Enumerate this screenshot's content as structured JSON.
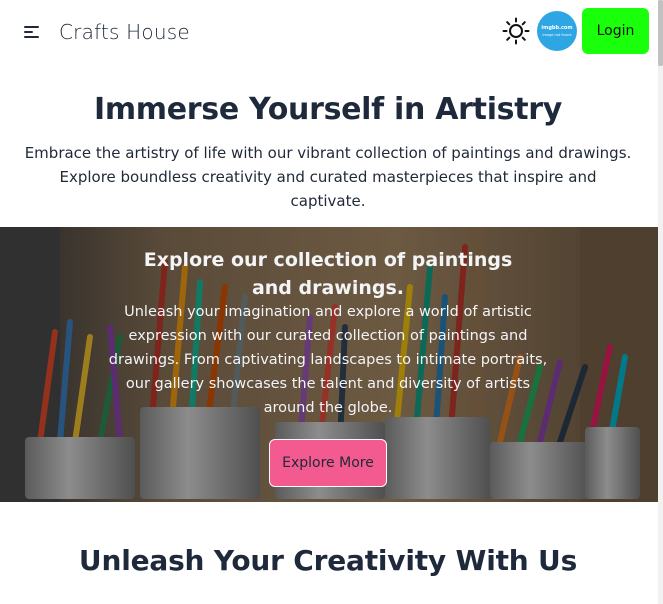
{
  "navbar": {
    "brand": "Crafts House",
    "menu_icon": "hamburger-icon",
    "theme_icon": "sun-icon",
    "avatar": {
      "line1": "imgbb.com",
      "line2": "image not found"
    },
    "login_label": "Login",
    "login_color": "#1aff0a"
  },
  "hero": {
    "title": "Immerse Yourself in Artistry",
    "description": "Embrace the artistry of life with our vibrant collection of paintings and drawings. Explore boundless creativity and curated masterpieces that inspire and captivate."
  },
  "banner": {
    "title": "Explore our collection of paintings and drawings.",
    "description": "Unleash your imagination and explore a world of artistic expression with our curated collection of paintings and drawings. From captivating landscapes to intimate portraits, our gallery showcases the talent and diversity of artists around the globe.",
    "button_label": "Explore More",
    "button_color": "#f25a90"
  },
  "section": {
    "title": "Unleash Your Creativity With Us"
  }
}
